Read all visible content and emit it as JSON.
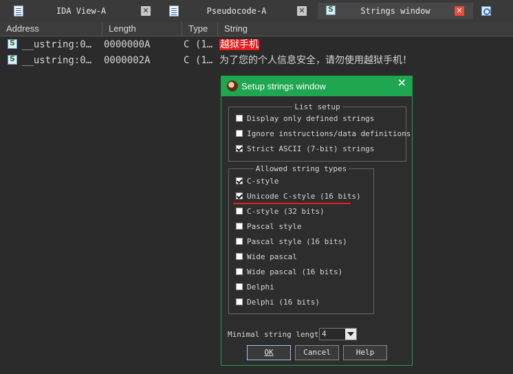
{
  "tabs": [
    {
      "label": "IDA View-A",
      "close": "✕",
      "icon": "doc-icon",
      "active": false
    },
    {
      "label": "Pseudocode-A",
      "close": "✕",
      "icon": "doc-icon",
      "active": false
    },
    {
      "label": "Strings window",
      "close": "✕",
      "icon": "strings-icon",
      "active": true
    }
  ],
  "table": {
    "columns": [
      "Address",
      "Length",
      "Type",
      "String"
    ],
    "rows": [
      {
        "address": "__ustring:0…",
        "length": "0000000A",
        "type": "C (1…",
        "string": "越狱手机",
        "highlight": true
      },
      {
        "address": "__ustring:0…",
        "length": "0000002A",
        "type": "C (1…",
        "string": "为了您的个人信息安全，请勿使用越狱手机！",
        "highlight": false
      }
    ]
  },
  "dialog": {
    "title": "Setup strings window",
    "close": "✕",
    "list_setup": {
      "legend": "List setup",
      "items": [
        {
          "label": "Display only defined strings",
          "checked": false
        },
        {
          "label": "Ignore instructions/data definitions",
          "checked": false
        },
        {
          "label": "Strict ASCII (7-bit) strings",
          "checked": true
        }
      ]
    },
    "string_types": {
      "legend": "Allowed string types",
      "items": [
        {
          "label": "C-style",
          "checked": true
        },
        {
          "label": "Unicode C-style (16 bits)",
          "checked": true
        },
        {
          "label": "C-style (32 bits)",
          "checked": false
        },
        {
          "label": "Pascal style",
          "checked": false
        },
        {
          "label": "Pascal style (16 bits)",
          "checked": false
        },
        {
          "label": "Wide pascal",
          "checked": false
        },
        {
          "label": "Wide pascal (16 bits)",
          "checked": false
        },
        {
          "label": "Delphi",
          "checked": false
        },
        {
          "label": "Delphi (16 bits)",
          "checked": false
        }
      ]
    },
    "min_length": {
      "label": "Minimal string length",
      "value": "4"
    },
    "buttons": {
      "ok": "OK",
      "cancel": "Cancel",
      "help": "Help"
    }
  },
  "colors": {
    "highlight": "#e61a1a",
    "dialog_title": "#1ea650",
    "annotation": "#e02020"
  }
}
